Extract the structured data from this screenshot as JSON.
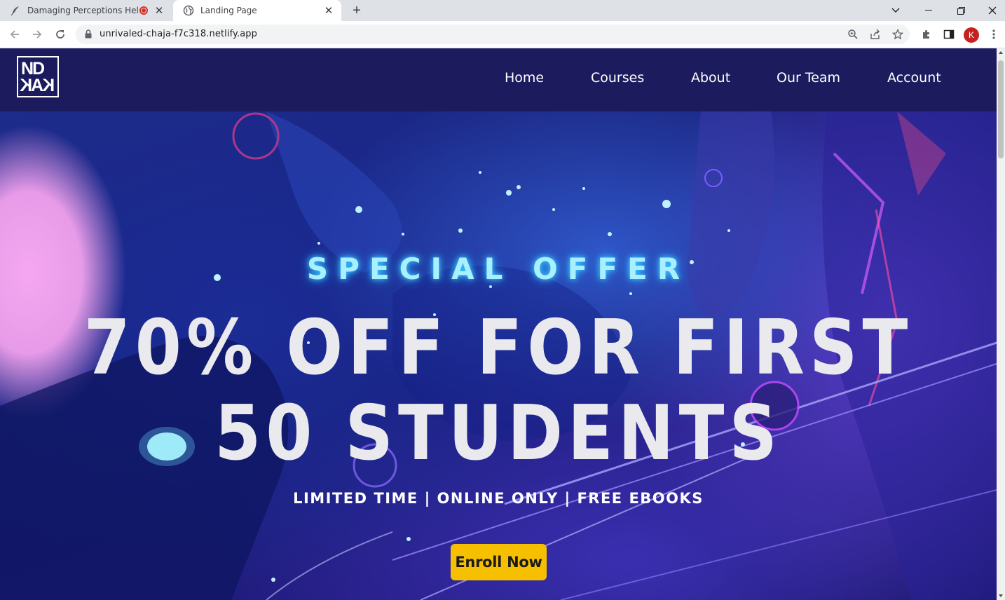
{
  "browser": {
    "tabs": [
      {
        "title": "Damaging Perceptions Help",
        "recording": true
      },
      {
        "title": "Landing Page",
        "active": true
      }
    ],
    "url": "unrivaled-chaja-f7c318.netlify.app",
    "profile_initial": "K"
  },
  "site": {
    "logo": {
      "line1": "ND",
      "line2": "KAK"
    },
    "nav": [
      "Home",
      "Courses",
      "About",
      "Our Team",
      "Account"
    ]
  },
  "hero": {
    "eyebrow": "SPECIAL OFFER",
    "headline_line1": "70% OFF FOR FIRST",
    "headline_line2": "50 STUDENTS",
    "subline": "LIMITED TIME | ONLINE ONLY | FREE EBOOKS",
    "cta_label": "Enroll Now"
  },
  "colors": {
    "nav_bg": "#1b1b5e",
    "cta_bg": "#f6c000",
    "eyebrow_glow": "#3fd2ff",
    "headline": "#e9e9ee"
  }
}
